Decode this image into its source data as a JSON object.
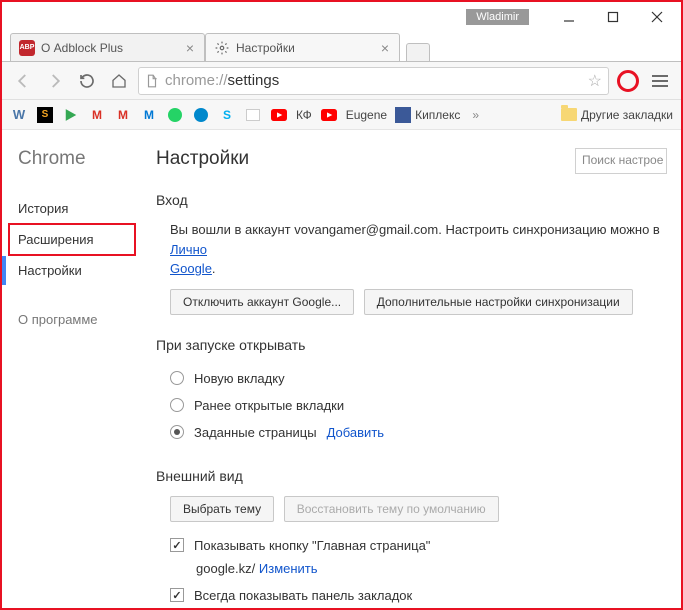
{
  "window": {
    "user": "Wladimir"
  },
  "tabs": [
    {
      "title": "О Adblock Plus",
      "icon": "abp"
    },
    {
      "title": "Настройки",
      "icon": "gear"
    }
  ],
  "omnibox": {
    "proto": "chrome://",
    "path": "settings"
  },
  "bookbar": {
    "kf": "КФ",
    "eugene": "Eugene",
    "kiplex": "Киплекс",
    "other": "Другие закладки"
  },
  "sidebar": {
    "brand": "Chrome",
    "history": "История",
    "extensions": "Расширения",
    "settings": "Настройки",
    "about": "О программе"
  },
  "page": {
    "title": "Настройки",
    "search_ph": "Поиск настрое",
    "login": {
      "heading": "Вход",
      "text_pre": "Вы вошли в аккаунт vovangamer@gmail.com. Настроить синхронизацию можно в ",
      "link1": "Лично",
      "link2": "Google",
      "period": ".",
      "btn_disconnect": "Отключить аккаунт Google...",
      "btn_sync": "Дополнительные настройки синхронизации"
    },
    "startup": {
      "heading": "При запуске открывать",
      "opt_newtab": "Новую вкладку",
      "opt_prev": "Ранее открытые вкладки",
      "opt_pages": "Заданные страницы",
      "add_link": "Добавить"
    },
    "appearance": {
      "heading": "Внешний вид",
      "btn_theme": "Выбрать тему",
      "btn_reset": "Восстановить тему по умолчанию",
      "chk_home": "Показывать кнопку \"Главная страница\"",
      "home_val": "google.kz/",
      "home_change": "Изменить",
      "chk_bookmarks": "Всегда показывать панель закладок"
    }
  }
}
